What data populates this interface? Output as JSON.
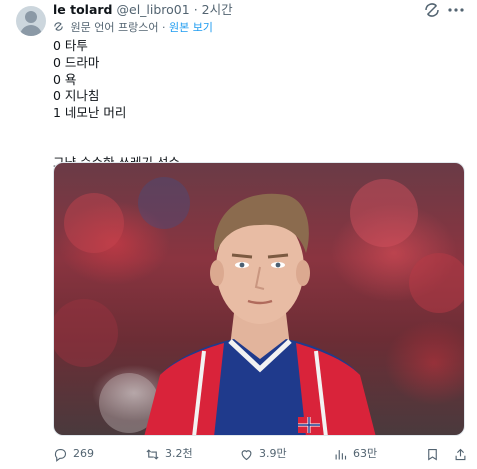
{
  "author": {
    "name": "le tolard",
    "handle": "@el_libro01",
    "separator": "·",
    "time": "2시간"
  },
  "translation": {
    "note": "원문 언어 프랑스어",
    "show_original": "원본 보기"
  },
  "post": {
    "lines": [
      "0 타투",
      "0 드라마",
      "0 욕",
      "0 지나침",
      "1 네모난 머리"
    ],
    "comment": "그냥 순수한 쓰레기 선수"
  },
  "media": {
    "icons": [
      "translate-icon",
      "more-icon"
    ]
  },
  "actions": {
    "replies": "269",
    "reposts": "3.2천",
    "likes": "3.9만",
    "views": "63만"
  },
  "colors": {
    "accent": "#1d9bf0",
    "text": "#0f1419",
    "muted": "#536471"
  }
}
